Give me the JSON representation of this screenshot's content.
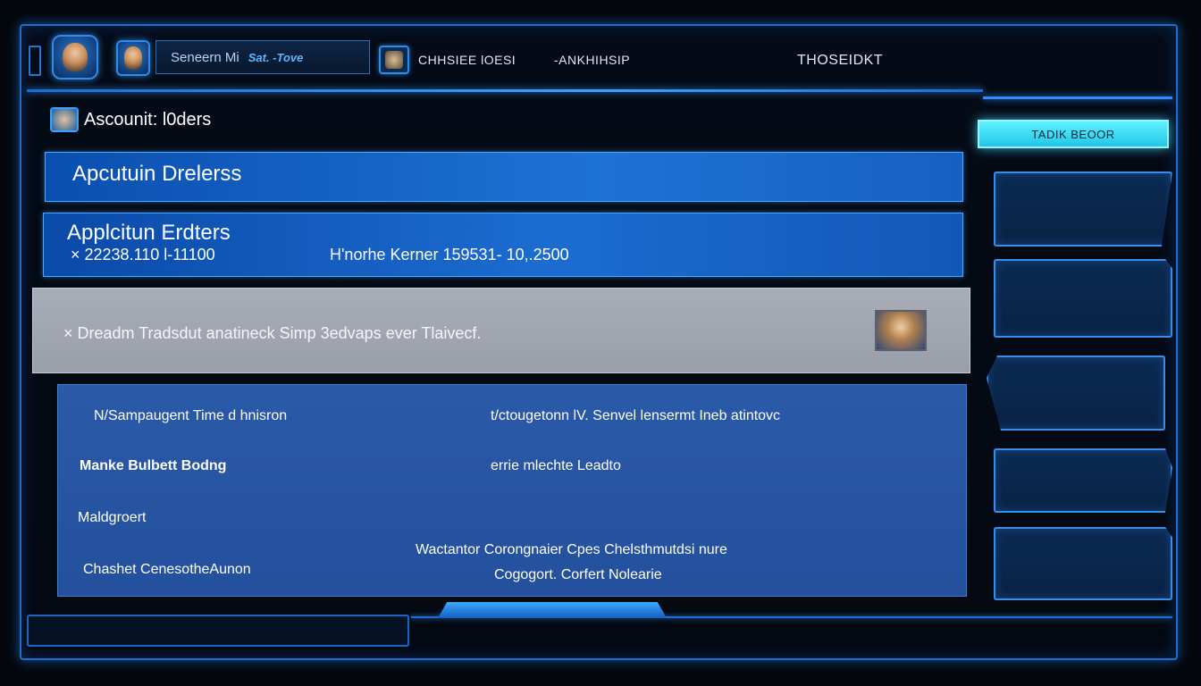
{
  "topbar": {
    "search_text": "Seneern Mi",
    "search_mark": "Sat. -Tove",
    "label_1": "CHHSIEE lOESI",
    "label_2": "-ANKHIHSIP",
    "label_3": "THOSEIDKT"
  },
  "page": {
    "title": "Ascounit: l0ders"
  },
  "bands": {
    "header": "Apcutuin Drelerss",
    "order_title": "Applcitun Erdters",
    "order_id": "× 22238.110 l-11100",
    "order_detail": "H'norhe Kerner 159531- 10,.2500"
  },
  "notice": {
    "text": "× Dreadm Tradsdut anatineck Simp 3edvaps ever Tlaivecf."
  },
  "info": {
    "row1_left": "N/Sampaugent Time d hnisron",
    "row1_right": "t/ctougetonn lV. Senvel lensermt Ineb atintovc",
    "row2_left": "Manke Bulbett Bodng",
    "row2_right": "errie mlechte Leadto",
    "row3_left": "Maldgroert",
    "row4_center": "Wactantor Corongnaier Cpes Chelsthmutdsi nure",
    "row5_left": "Chashet CenesotheAunon",
    "row5_right": "Cogogort. Corfert Nolearie"
  },
  "sidebar": {
    "action_button": "TADIK BEOOR"
  },
  "colors": {
    "accent": "#2a8cff",
    "cyan": "#5ff0ff",
    "panel": "#1e72d4",
    "notice": "#a9adb7"
  }
}
